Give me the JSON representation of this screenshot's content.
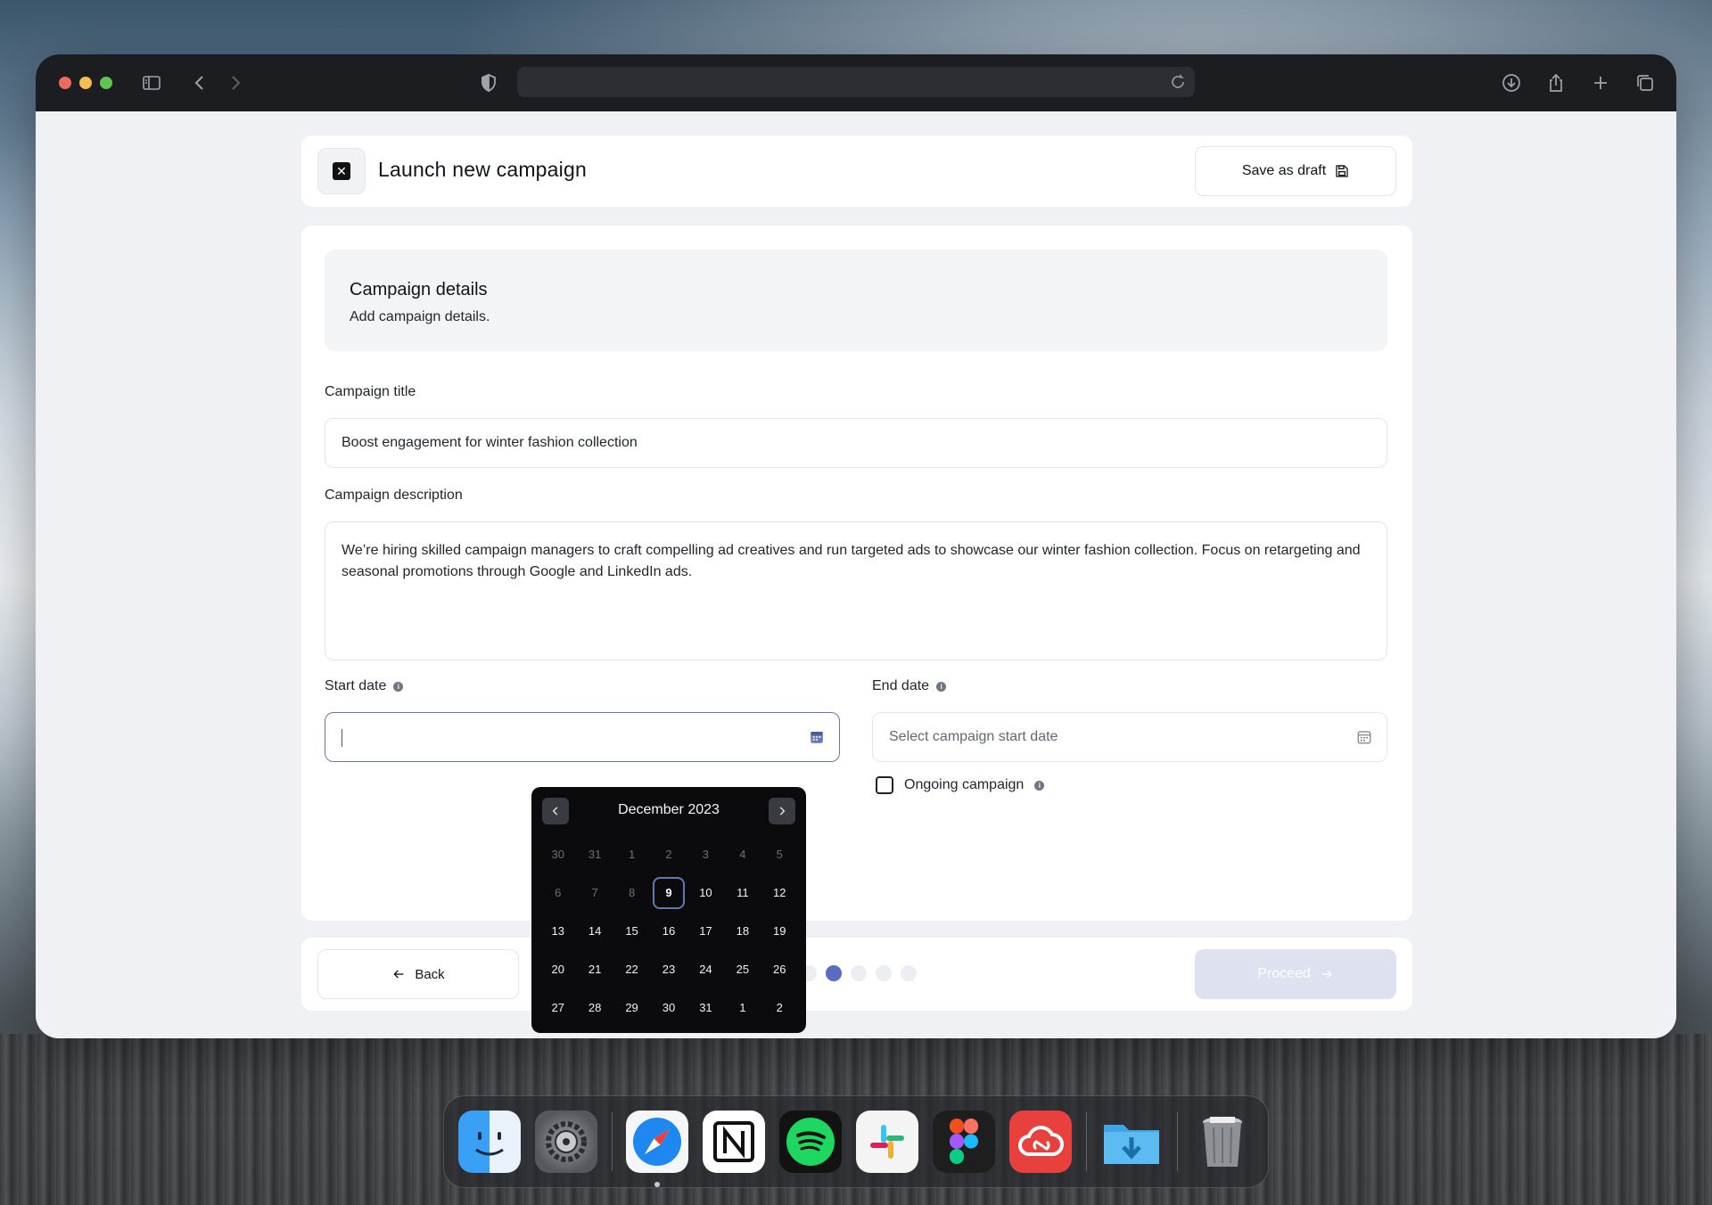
{
  "header": {
    "title": "Launch new campaign",
    "save_draft_label": "Save as draft"
  },
  "section": {
    "title": "Campaign details",
    "subtitle": "Add campaign details."
  },
  "fields": {
    "title_label": "Campaign title",
    "title_value": "Boost engagement for winter fashion collection",
    "description_label": "Campaign description",
    "description_value": "We’re hiring skilled campaign managers to craft compelling ad creatives and run targeted ads to showcase our winter fashion collection. Focus on retargeting and seasonal promotions through Google and LinkedIn ads.",
    "start_label": "Start date",
    "start_value": "",
    "end_label": "End date",
    "end_placeholder": "Select campaign start date",
    "ongoing_label": "Ongoing campaign"
  },
  "calendar": {
    "month_label": "December 2023",
    "selected_day": "9",
    "weeks": [
      [
        {
          "d": "30",
          "m": true
        },
        {
          "d": "31",
          "m": true
        },
        {
          "d": "1",
          "m": true
        },
        {
          "d": "2",
          "m": true
        },
        {
          "d": "3",
          "m": true
        },
        {
          "d": "4",
          "m": true
        },
        {
          "d": "5",
          "m": true
        }
      ],
      [
        {
          "d": "6",
          "m": true
        },
        {
          "d": "7",
          "m": true
        },
        {
          "d": "8",
          "m": true
        },
        {
          "d": "9",
          "s": true
        },
        {
          "d": "10"
        },
        {
          "d": "11"
        },
        {
          "d": "12"
        }
      ],
      [
        {
          "d": "13"
        },
        {
          "d": "14"
        },
        {
          "d": "15"
        },
        {
          "d": "16"
        },
        {
          "d": "17"
        },
        {
          "d": "18"
        },
        {
          "d": "19"
        }
      ],
      [
        {
          "d": "20"
        },
        {
          "d": "21"
        },
        {
          "d": "22"
        },
        {
          "d": "23"
        },
        {
          "d": "24"
        },
        {
          "d": "25"
        },
        {
          "d": "26"
        }
      ],
      [
        {
          "d": "27"
        },
        {
          "d": "28"
        },
        {
          "d": "29"
        },
        {
          "d": "30"
        },
        {
          "d": "31"
        },
        {
          "d": "1"
        },
        {
          "d": "2"
        }
      ]
    ]
  },
  "footer": {
    "back_label": "Back",
    "proceed_label": "Proceed",
    "steps_total": 5,
    "current_step": 2
  },
  "dock": {
    "apps": [
      "finder-icon",
      "system-settings-icon",
      "safari-icon",
      "notion-icon",
      "spotify-icon",
      "slack-icon",
      "figma-icon",
      "creative-cloud-icon",
      "downloads-folder-icon",
      "trash-icon"
    ]
  },
  "colors": {
    "accent": "#5b6cc0",
    "proceed_disabled": "#dde1f0",
    "calendar_bg": "#0b0b0d"
  }
}
